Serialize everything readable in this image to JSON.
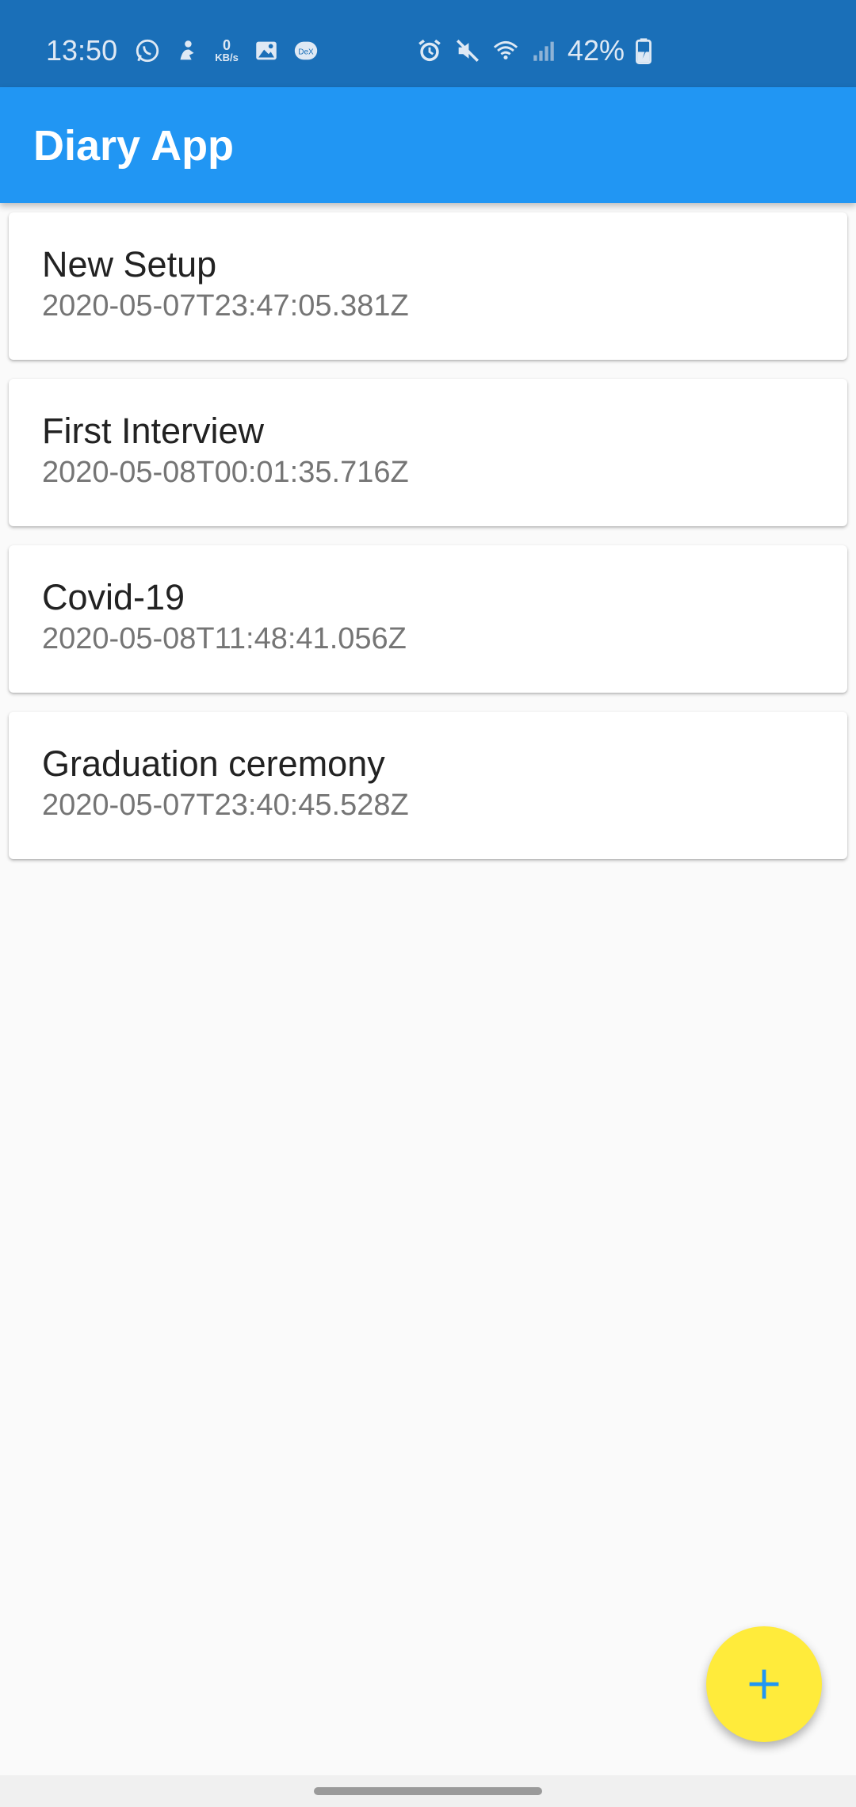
{
  "status_bar": {
    "time": "13:50",
    "net_speed_value": "0",
    "net_speed_unit": "KB/s",
    "battery_percent": "42%",
    "icons_left": [
      "whatsapp-icon",
      "app-notification-icon",
      "network-speed-icon",
      "image-icon",
      "dex-icon"
    ],
    "icons_right": [
      "alarm-icon",
      "mute-icon",
      "wifi-icon",
      "signal-icon",
      "battery-charging-icon"
    ],
    "background_color": "#1a6fb8"
  },
  "app_bar": {
    "title": "Diary App",
    "background_color": "#2196f3"
  },
  "entries": [
    {
      "title": "New Setup",
      "date": "2020-05-07T23:47:05.381Z"
    },
    {
      "title": "First Interview",
      "date": "2020-05-08T00:01:35.716Z"
    },
    {
      "title": "Covid-19",
      "date": "2020-05-08T11:48:41.056Z"
    },
    {
      "title": "Graduation ceremony",
      "date": "2020-05-07T23:40:45.528Z"
    }
  ],
  "fab": {
    "icon": "plus-icon",
    "background_color": "#ffeb3b",
    "icon_color": "#2196f3"
  }
}
